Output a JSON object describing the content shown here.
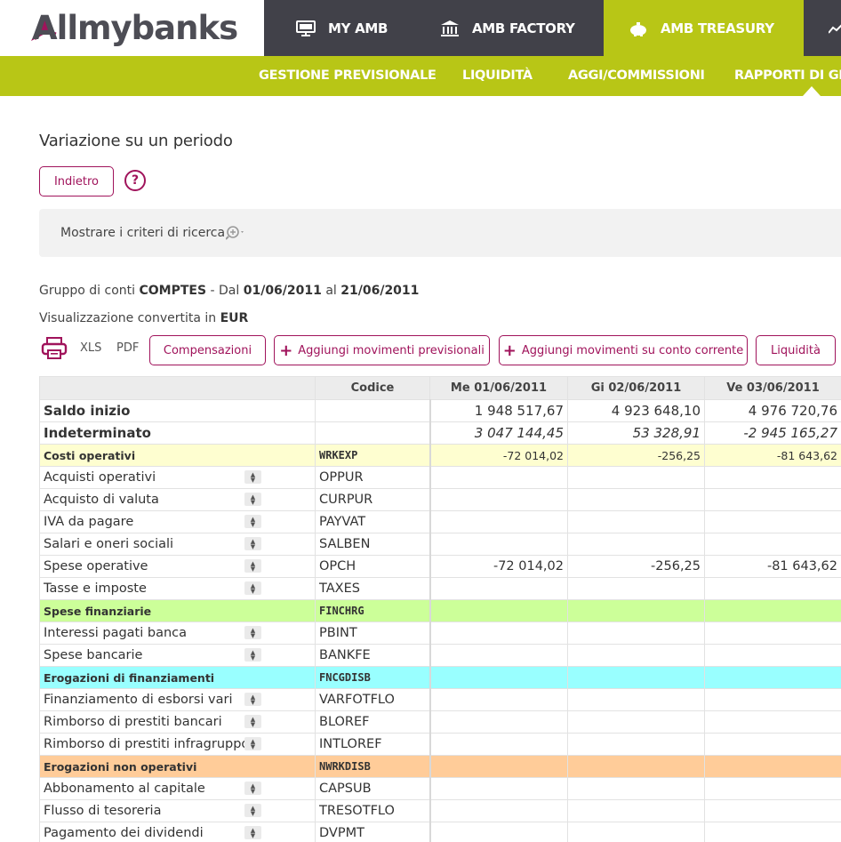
{
  "brand": {
    "logo_text": "Allmybanks"
  },
  "main_nav": [
    {
      "label": "MY AMB",
      "icon": "monitor-icon",
      "active": false
    },
    {
      "label": "AMB FACTORY",
      "icon": "bank-icon",
      "active": false
    },
    {
      "label": "AMB TREASURY",
      "icon": "piggy-bank-icon",
      "active": true
    },
    {
      "label": "",
      "icon": "chart-line-icon",
      "active": false
    }
  ],
  "sub_nav": [
    "GESTIONE PREVISIONALE",
    "LIQUIDITÀ",
    "AGGI/COMMISSIONI",
    "RAPPORTI DI GES"
  ],
  "page": {
    "title": "Variazione su un periodo",
    "back_button": "Indietro",
    "help": "?",
    "criteria_label": "Mostrare i criteri di ricerca"
  },
  "info": {
    "group_prefix": "Gruppo di conti",
    "group_name": "COMPTES",
    "from_prefix": "- Dal",
    "date_from": "01/06/2011",
    "to_prefix": "al",
    "date_to": "21/06/2011",
    "currency_prefix": "Visualizzazione convertita in",
    "currency": "EUR"
  },
  "toolbar": {
    "xls": "XLS",
    "pdf": "PDF",
    "compensate": "Compensazioni",
    "add_forecast": "Aggiungi movimenti previsionali",
    "add_current": "Aggiungi movimenti su conto corrente",
    "liquidity": "Liquidità"
  },
  "table": {
    "code_header": "Codice",
    "date_headers": [
      "Me 01/06/2011",
      "Gi 02/06/2011",
      "Ve 03/06/2011"
    ],
    "rows": [
      {
        "type": "balance",
        "label": "Saldo inizio",
        "code": "",
        "values": [
          "1 948 517,67",
          "4 923 648,10",
          "4 976 720,76"
        ]
      },
      {
        "type": "balance-italic",
        "label": "Indeterminato",
        "code": "",
        "values": [
          "3 047 144,45",
          "53 328,91",
          "-2 945 165,27"
        ]
      },
      {
        "type": "group",
        "color": "#fefed0",
        "label": "Costi operativi",
        "code": "WRKEXP",
        "values": [
          "-72 014,02",
          "-256,25",
          "-81 643,62"
        ]
      },
      {
        "type": "item",
        "label": "Acquisti operativi",
        "code": "OPPUR",
        "values": [
          "",
          "",
          ""
        ]
      },
      {
        "type": "item",
        "label": "Acquisto di valuta",
        "code": "CURPUR",
        "values": [
          "",
          "",
          ""
        ]
      },
      {
        "type": "item",
        "label": "IVA da pagare",
        "code": "PAYVAT",
        "values": [
          "",
          "",
          ""
        ]
      },
      {
        "type": "item",
        "label": "Salari e oneri sociali",
        "code": "SALBEN",
        "values": [
          "",
          "",
          ""
        ]
      },
      {
        "type": "item",
        "label": "Spese operative",
        "code": "OPCH",
        "values": [
          "-72 014,02",
          "-256,25",
          "-81 643,62"
        ]
      },
      {
        "type": "item",
        "label": "Tasse e imposte",
        "code": "TAXES",
        "values": [
          "",
          "",
          ""
        ]
      },
      {
        "type": "group",
        "color": "#ccff99",
        "label": "Spese finanziarie",
        "code": "FINCHRG",
        "values": [
          "",
          "",
          ""
        ]
      },
      {
        "type": "item",
        "label": "Interessi pagati banca",
        "code": "PBINT",
        "values": [
          "",
          "",
          ""
        ]
      },
      {
        "type": "item",
        "label": "Spese bancarie",
        "code": "BANKFE",
        "values": [
          "",
          "",
          ""
        ]
      },
      {
        "type": "group",
        "color": "#99ffff",
        "label": "Erogazioni di finanziamenti",
        "code": "FNCGDISB",
        "values": [
          "",
          "",
          ""
        ]
      },
      {
        "type": "item",
        "label": "Finanziamento di esborsi vari",
        "code": "VARFOTFLO",
        "values": [
          "",
          "",
          ""
        ]
      },
      {
        "type": "item",
        "label": "Rimborso di prestiti bancari",
        "code": "BLOREF",
        "values": [
          "",
          "",
          ""
        ]
      },
      {
        "type": "item",
        "label": "Rimborso di prestiti infragruppo",
        "code": "INTLOREF",
        "values": [
          "",
          "",
          ""
        ]
      },
      {
        "type": "group",
        "color": "#ffcc99",
        "label": "Erogazioni non operativi",
        "code": "NWRKDISB",
        "values": [
          "",
          "",
          ""
        ]
      },
      {
        "type": "item",
        "label": "Abbonamento al capitale",
        "code": "CAPSUB",
        "values": [
          "",
          "",
          ""
        ]
      },
      {
        "type": "item",
        "label": "Flusso di tesoreria",
        "code": "TRESOTFLO",
        "values": [
          "",
          "",
          ""
        ]
      },
      {
        "type": "item",
        "label": "Pagamento dei dividendi",
        "code": "DVPMT",
        "values": [
          "",
          "",
          ""
        ]
      }
    ]
  },
  "colors": {
    "accent": "#b8c616",
    "brand": "#a0135b",
    "topbar": "#414149"
  }
}
